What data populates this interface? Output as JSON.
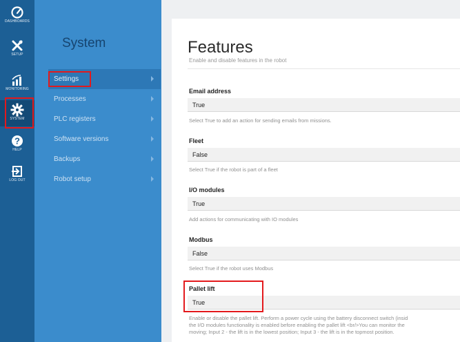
{
  "rail": {
    "items": [
      {
        "label": "DASHBOARDS",
        "icon": "dashboard-gauge-icon"
      },
      {
        "label": "SETUP",
        "icon": "tools-icon"
      },
      {
        "label": "MONITORING",
        "icon": "signal-bars-icon"
      },
      {
        "label": "SYSTEM",
        "icon": "gear-icon"
      },
      {
        "label": "HELP",
        "icon": "help-circle-icon"
      },
      {
        "label": "LOG OUT",
        "icon": "logout-icon"
      }
    ]
  },
  "subnav": {
    "title": "System",
    "items": [
      {
        "label": "Settings"
      },
      {
        "label": "Processes"
      },
      {
        "label": "PLC registers"
      },
      {
        "label": "Software versions"
      },
      {
        "label": "Backups"
      },
      {
        "label": "Robot setup"
      }
    ]
  },
  "content": {
    "title": "Features",
    "subtitle": "Enable and disable features in the robot",
    "fields": [
      {
        "label": "Email address",
        "value": "True",
        "help": "Select True to add an action for sending emails from missions."
      },
      {
        "label": "Fleet",
        "value": "False",
        "help": "Select True if the robot is part of a fleet"
      },
      {
        "label": "I/O modules",
        "value": "True",
        "help": "Add actions for communicating with IO modules"
      },
      {
        "label": "Modbus",
        "value": "False",
        "help": "Select True if the robot uses Modbus"
      },
      {
        "label": "Pallet lift",
        "value": "True",
        "help_lines": [
          "Enable or disable the pallet lift. Perform a power cycle using the battery disconnect switch (insid",
          "the I/O modules functionality is enabled before enabling the pallet lift <br/>You can monitor the",
          "moving; Input 2 - the lift is in the lowest position; Input 3 - the lift is in the topmost position."
        ]
      }
    ]
  },
  "colors": {
    "rail_bg": "#1c5f95",
    "subnav_bg": "#3b8ccc",
    "highlight": "#e3191c"
  }
}
